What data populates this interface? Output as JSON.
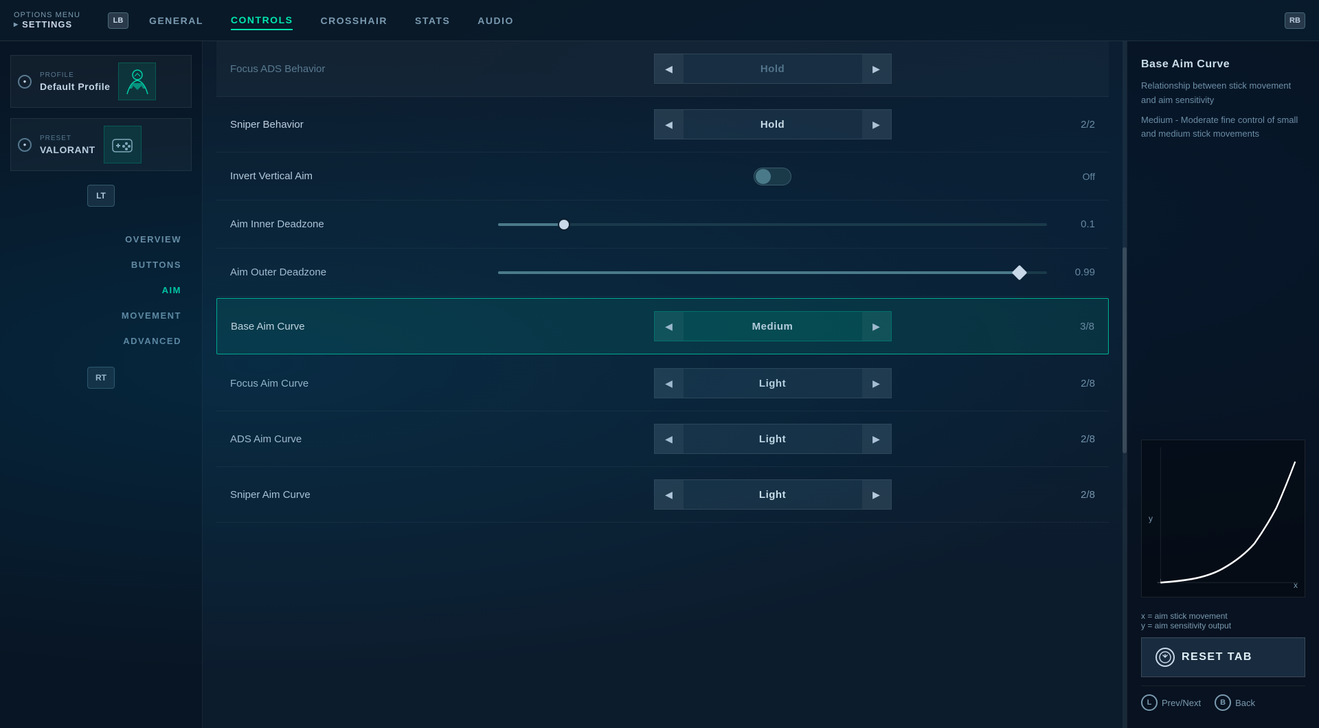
{
  "topNav": {
    "optionsMenu": "OPTIONS MENU",
    "settings": "SETTINGS",
    "lbLabel": "LB",
    "rbLabel": "RB",
    "tabs": [
      {
        "label": "GENERAL",
        "active": false
      },
      {
        "label": "CONTROLS",
        "active": true
      },
      {
        "label": "CROSSHAIR",
        "active": false
      },
      {
        "label": "STATS",
        "active": false
      },
      {
        "label": "AUDIO",
        "active": false
      }
    ]
  },
  "sidebar": {
    "profileLabel": "PROFILE",
    "profileName": "Default Profile",
    "presetLabel": "PRESET",
    "presetName": "VALORANT",
    "ltLabel": "LT",
    "rtLabel": "RT",
    "navItems": [
      {
        "label": "OVERVIEW",
        "active": false
      },
      {
        "label": "BUTTONS",
        "active": false
      },
      {
        "label": "AIM",
        "active": true
      },
      {
        "label": "MOVEMENT",
        "active": false
      },
      {
        "label": "ADVANCED",
        "active": false
      }
    ]
  },
  "settings": [
    {
      "id": "sniper-behavior",
      "label": "Sniper Behavior",
      "type": "select",
      "value": "Hold",
      "counter": "2/2"
    },
    {
      "id": "invert-vertical-aim",
      "label": "Invert Vertical Aim",
      "type": "toggle",
      "value": false,
      "statusText": "Off"
    },
    {
      "id": "aim-inner-deadzone",
      "label": "Aim Inner Deadzone",
      "type": "slider",
      "value": 0.1,
      "percent": 12,
      "displayValue": "0.1"
    },
    {
      "id": "aim-outer-deadzone",
      "label": "Aim Outer Deadzone",
      "type": "slider",
      "value": 0.99,
      "percent": 95,
      "displayValue": "0.99"
    },
    {
      "id": "base-aim-curve",
      "label": "Base Aim Curve",
      "type": "select",
      "value": "Medium",
      "counter": "3/8",
      "highlighted": true
    },
    {
      "id": "focus-aim-curve",
      "label": "Focus Aim Curve",
      "type": "select",
      "value": "Light",
      "counter": "2/8"
    },
    {
      "id": "ads-aim-curve",
      "label": "ADS Aim Curve",
      "type": "select",
      "value": "Light",
      "counter": "2/8"
    },
    {
      "id": "sniper-aim-curve",
      "label": "Sniper Aim Curve",
      "type": "select",
      "value": "Light",
      "counter": "2/8"
    }
  ],
  "rightPanel": {
    "title": "Base Aim Curve",
    "description1": "Relationship between stick movement and aim sensitivity",
    "description2": "Medium - Moderate fine control of small and medium stick movements",
    "axisLabelX": "x = aim stick movement",
    "axisLabelY": "y = aim sensitivity output",
    "yAxisLabel": "y",
    "xAxisLabel": "x",
    "resetTabLabel": "RESET TAB",
    "yButtonLabel": "Y",
    "bottomControls": {
      "prevNextLabel": "Prev/Next",
      "backLabel": "Back",
      "lLabel": "L",
      "bLabel": "B"
    }
  }
}
